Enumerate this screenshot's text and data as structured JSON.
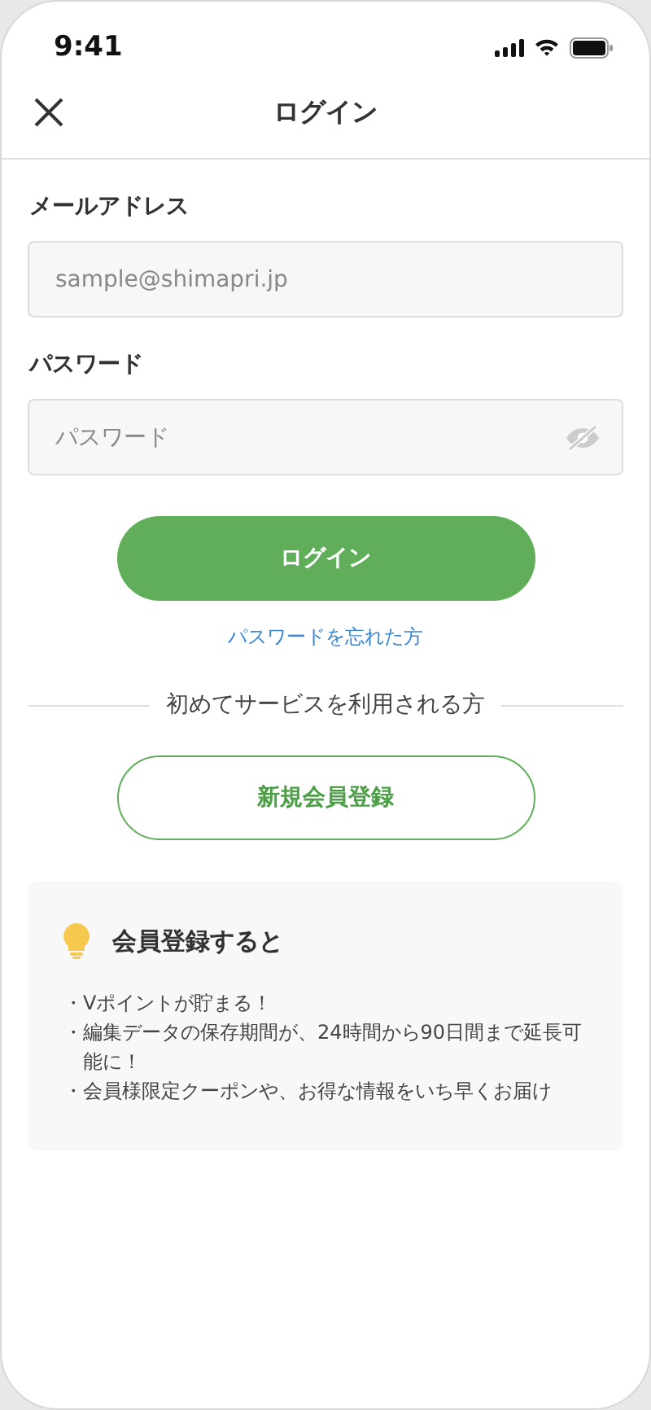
{
  "status_bar": {
    "time": "9:41"
  },
  "header": {
    "title": "ログイン"
  },
  "email": {
    "label": "メールアドレス",
    "placeholder": "sample@shimapri.jp"
  },
  "password": {
    "label": "パスワード",
    "placeholder": "パスワード"
  },
  "login_button": "ログイン",
  "forgot_link": "パスワードを忘れた方",
  "divider_text": "初めてサービスを利用される方",
  "register_button": "新規会員登録",
  "benefits": {
    "title": "会員登録すると",
    "items": [
      "・Vポイントが貯まる！",
      "・編集データの保存期間が、24時間から90日間まで延長可能に！",
      "・会員様限定クーポンや、お得な情報をいち早くお届け"
    ]
  }
}
